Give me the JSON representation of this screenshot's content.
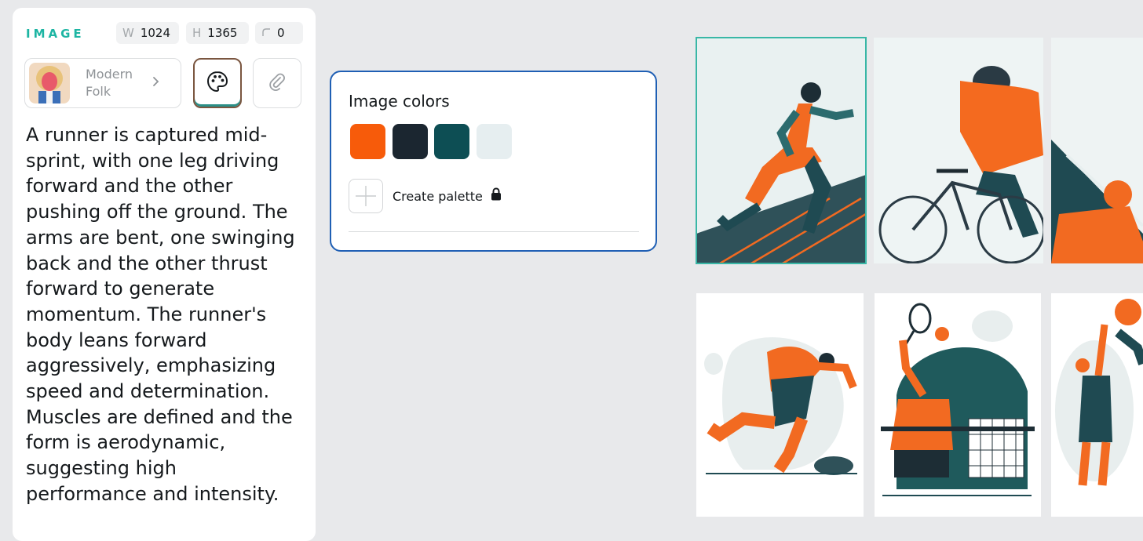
{
  "panel": {
    "section_label": "IMAGE",
    "width_key": "W",
    "width_value": "1024",
    "height_key": "H",
    "height_value": "1365",
    "radius_value": "0",
    "style_name": "Modern Folk",
    "prompt": "A runner is captured mid-sprint, with one leg driving forward and the other pushing off the ground. The arms are bent, one swinging back and the other thrust forward to generate momentum. The runner's body leans forward aggressively, emphasizing speed and determination. Muscles are defined and the form is aerodynamic, suggesting high performance and intensity."
  },
  "popup": {
    "title": "Image colors",
    "swatches": [
      "#f75b0a",
      "#1b2630",
      "#0d4e54",
      "#e6eef0"
    ],
    "create_label": "Create palette"
  },
  "icons": [
    "chevron-right-icon",
    "palette-icon",
    "paperclip-icon",
    "plus-icon",
    "lock-icon"
  ],
  "colors": {
    "accent": "#1db5a3",
    "popup_border": "#1f5fb4",
    "selected_card": "#39b7a6"
  }
}
